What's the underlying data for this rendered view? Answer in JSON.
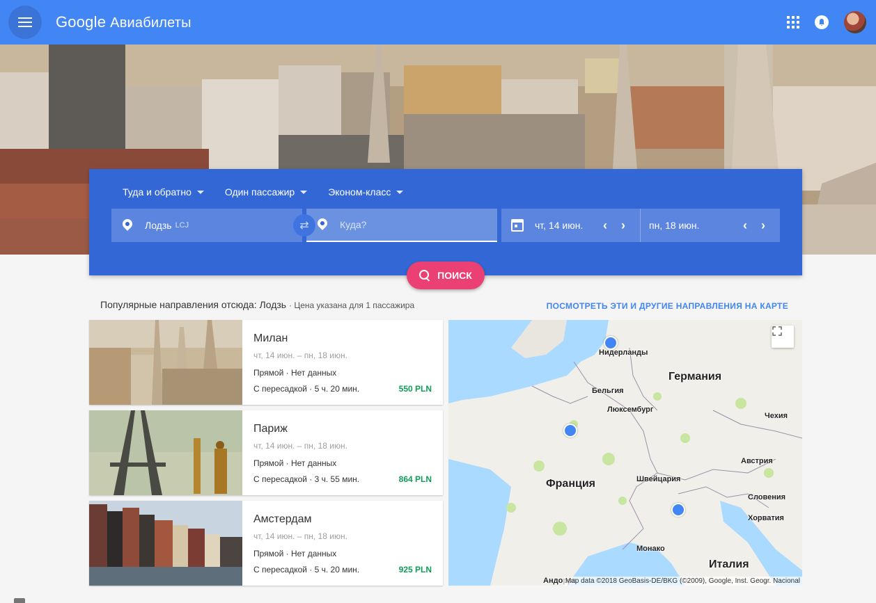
{
  "header": {
    "brand": "Google",
    "product": "Авиабилеты",
    "menu_icon": "hamburger-menu-icon",
    "apps_icon": "apps-grid-icon",
    "notifications_icon": "bell-icon"
  },
  "search": {
    "trip_type": "Туда и обратно",
    "passengers": "Один пассажир",
    "cabin_class": "Эконом-класс",
    "origin_city": "Лодзь",
    "origin_code": "LCJ",
    "destination_placeholder": "Куда?",
    "depart_date": "чт, 14 июн.",
    "return_date": "пн, 18 июн.",
    "search_label": "ПОИСК"
  },
  "popular": {
    "heading": "Популярные направления отсюда: Лодзь",
    "subheading": "· Цена указана для 1 пассажира",
    "map_link": "ПОСМОТРЕТЬ ЭТИ И ДРУГИЕ НАПРАВЛЕНИЯ НА КАРТЕ",
    "destinations": [
      {
        "city": "Милан",
        "dates": "чт, 14 июн. – пн, 18 июн.",
        "direct": "Прямой · Нет данных",
        "connection": "С пересадкой · 5 ч. 20 мин.",
        "price": "550 PLN"
      },
      {
        "city": "Париж",
        "dates": "чт, 14 июн. – пн, 18 июн.",
        "direct": "Прямой · Нет данных",
        "connection": "С пересадкой · 3 ч. 55 мин.",
        "price": "864 PLN"
      },
      {
        "city": "Амстердам",
        "dates": "чт, 14 июн. – пн, 18 июн.",
        "direct": "Прямой · Нет данных",
        "connection": "С пересадкой · 5 ч. 20 мин.",
        "price": "925 PLN"
      }
    ]
  },
  "map": {
    "countries": {
      "netherlands": "Нидерланды",
      "germany": "Германия",
      "belgium": "Бельгия",
      "luxembourg": "Люксембург",
      "czechia": "Чехия",
      "austria": "Австрия",
      "france": "Франция",
      "switzerland": "Швейцария",
      "slovenia": "Словения",
      "croatia": "Хорватия",
      "monaco": "Монако",
      "italy": "Италия",
      "andorra": "Андорра"
    },
    "attribution": "Map data ©2018 GeoBasis-DE/BKG (©2009), Google, Inst. Geogr. Nacional",
    "colors": {
      "land": "#f1efe9",
      "water": "#aadaff",
      "park": "#c8e6a0",
      "pin": "#4285f4"
    }
  },
  "colors": {
    "topbar": "#4285f4",
    "search_panel": "#3367d6",
    "search_button": "#ea4073",
    "price": "#0f9d58",
    "link": "#4285f4"
  }
}
